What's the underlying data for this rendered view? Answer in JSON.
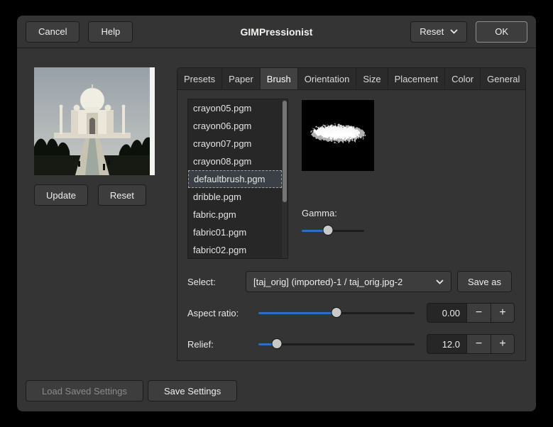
{
  "header": {
    "cancel": "Cancel",
    "help": "Help",
    "title": "GIMPressionist",
    "reset": "Reset",
    "ok": "OK"
  },
  "preview_panel": {
    "update": "Update",
    "reset": "Reset"
  },
  "tabs": [
    {
      "label": "Presets",
      "active": false
    },
    {
      "label": "Paper",
      "active": false
    },
    {
      "label": "Brush",
      "active": true
    },
    {
      "label": "Orientation",
      "active": false
    },
    {
      "label": "Size",
      "active": false
    },
    {
      "label": "Placement",
      "active": false
    },
    {
      "label": "Color",
      "active": false
    },
    {
      "label": "General",
      "active": false
    }
  ],
  "brush_tab": {
    "files": [
      "crayon05.pgm",
      "crayon06.pgm",
      "crayon07.pgm",
      "crayon08.pgm",
      "defaultbrush.pgm",
      "dribble.pgm",
      "fabric.pgm",
      "fabric01.pgm",
      "fabric02.pgm"
    ],
    "selected_file": "defaultbrush.pgm",
    "gamma_label": "Gamma:",
    "select_label": "Select:",
    "select_value": "[taj_orig] (imported)-1 / taj_orig.jpg-2",
    "save_as": "Save as",
    "aspect_ratio_label": "Aspect ratio:",
    "aspect_ratio_value": "0.00",
    "relief_label": "Relief:",
    "relief_value": "12.0",
    "sliders": {
      "gamma": 42,
      "aspect": 50,
      "relief": 12
    },
    "spin_minus": "−",
    "spin_plus": "+"
  },
  "footer": {
    "load_saved": "Load Saved Settings",
    "save_settings": "Save Settings"
  },
  "colors": {
    "accent_blue": "#2f6fc0",
    "dialog_bg": "#343434",
    "window_frame": "#000000"
  }
}
